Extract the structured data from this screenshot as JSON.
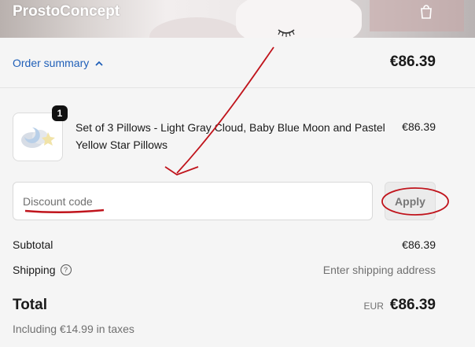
{
  "header": {
    "brand": "ProstoConcept"
  },
  "summary": {
    "toggle_label": "Order summary",
    "total": "€86.39"
  },
  "product": {
    "quantity": "1",
    "title": "Set of 3 Pillows - Light Gray Cloud, Baby Blue Moon and Pastel Yellow Star Pillows",
    "price": "€86.39"
  },
  "discount": {
    "placeholder": "Discount code",
    "apply_label": "Apply"
  },
  "totals": {
    "subtotal_label": "Subtotal",
    "subtotal_value": "€86.39",
    "shipping_label": "Shipping",
    "shipping_value": "Enter shipping address",
    "total_label": "Total",
    "currency": "EUR",
    "total_value": "€86.39",
    "taxes_note": "Including €14.99 in taxes"
  },
  "colors": {
    "link": "#1f5fb8",
    "annotation": "#c0141c"
  }
}
